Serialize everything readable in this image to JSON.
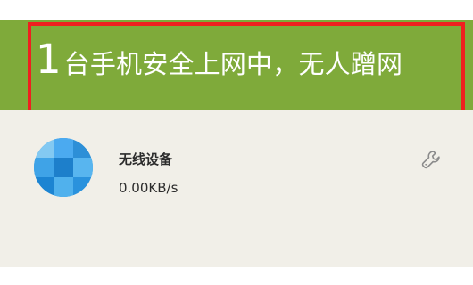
{
  "header": {
    "connected_count": "1",
    "message": "台手机安全上网中，无人蹭网"
  },
  "device": {
    "name": "无线设备",
    "speed": "0.00KB/s"
  },
  "icons": {
    "device_avatar": "pixelated-avatar-icon",
    "settings": "wrench-icon"
  },
  "colors": {
    "header_background": "#7faa3a",
    "highlight_border": "#ef1f1f",
    "panel_background": "#f1efe8",
    "avatar_blue": "#2b95dc"
  }
}
